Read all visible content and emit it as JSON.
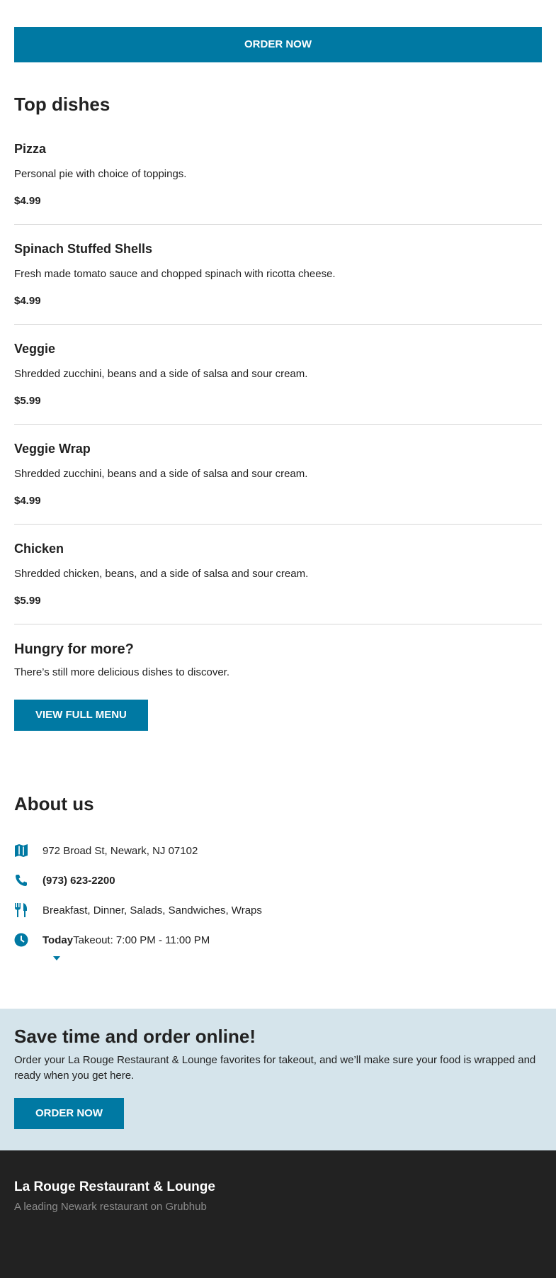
{
  "header": {
    "order_now_label": "ORDER NOW"
  },
  "top_dishes": {
    "title": "Top dishes",
    "items": [
      {
        "name": "Pizza",
        "description": "Personal pie with choice of toppings.",
        "price": "$4.99"
      },
      {
        "name": "Spinach Stuffed Shells",
        "description": "Fresh made tomato sauce and chopped spinach with ricotta cheese.",
        "price": "$4.99"
      },
      {
        "name": "Veggie",
        "description": "Shredded zucchini, beans and a side of salsa and sour cream.",
        "price": "$5.99"
      },
      {
        "name": "Veggie Wrap",
        "description": "Shredded zucchini, beans and a side of salsa and sour cream.",
        "price": "$4.99"
      },
      {
        "name": "Chicken",
        "description": "Shredded chicken, beans, and a side of salsa and sour cream.",
        "price": "$5.99"
      }
    ]
  },
  "hungry": {
    "title": "Hungry for more?",
    "text": "There’s still more delicious dishes to discover.",
    "button_label": "VIEW FULL MENU"
  },
  "about": {
    "title": "About us",
    "address": "972 Broad St, Newark, NJ 07102",
    "phone": "(973) 623-2200",
    "cuisines": "Breakfast, Dinner, Salads, Sandwiches, Wraps",
    "hours_day": "Today",
    "hours_text": "Takeout: 7:00 PM - 11:00 PM"
  },
  "promo": {
    "title": "Save time and order online!",
    "text": "Order your La Rouge Restaurant & Lounge favorites for takeout, and we’ll make sure your food is wrapped and ready when you get here.",
    "button_label": "ORDER NOW"
  },
  "footer": {
    "name": "La Rouge Restaurant & Lounge",
    "tagline": "A leading Newark restaurant on Grubhub"
  },
  "colors": {
    "accent": "#0079a3",
    "promo_bg": "#d5e4eb",
    "footer_bg": "#222222"
  },
  "icons": {
    "address": "map-icon",
    "phone": "phone-icon",
    "cuisines": "fork-knife-icon",
    "hours": "clock-icon"
  }
}
